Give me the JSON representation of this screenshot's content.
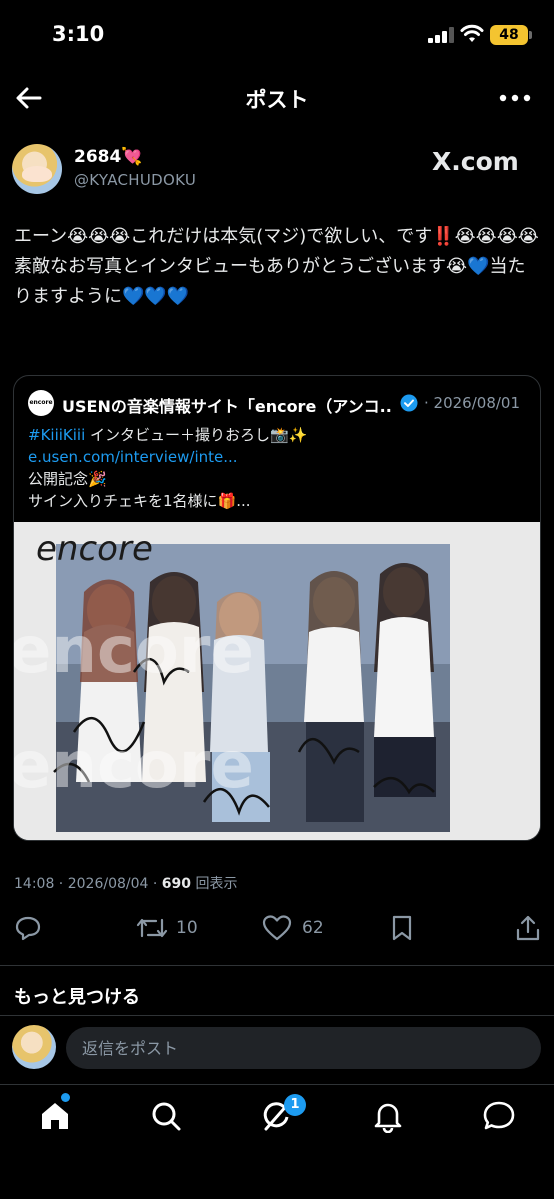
{
  "status_bar": {
    "time": "3:10",
    "battery": "48"
  },
  "nav": {
    "title": "ポスト"
  },
  "author": {
    "name": "2684💘",
    "handle": "@KYACHUDOKU",
    "watermark": "X.com"
  },
  "tweet": {
    "text": "エーン😭😭😭これだけは本気(マジ)で欲しい、です‼️😭😭😭😭\n素敵なお写真とインタビューもありがとうございます😭💙当たりますように💙💙💙"
  },
  "quote": {
    "logo_text": "encore",
    "account_name": "USENの音楽情報サイト「encore（アンコ...",
    "date": "2026/08/01",
    "hashtag": "#KiiiKiii",
    "line1_rest": " インタビュー＋撮りおろし📸✨",
    "link": "e.usen.com/interview/inte...",
    "line3": "公開記念🎉",
    "line4": "サイン入りチェキを1名様に🎁...",
    "image_watermark": "encore"
  },
  "meta": {
    "time": "14:08",
    "date": "2026/08/04",
    "views": "690",
    "views_label": "回表示"
  },
  "actions": {
    "retweets": "10",
    "likes": "62"
  },
  "discover_label": "もっと見つける",
  "reply": {
    "placeholder": "返信をポスト"
  },
  "tabbar": {
    "notifications_badge": "1"
  },
  "colors": {
    "accent": "#1d9bf0",
    "background": "#000000",
    "muted": "#8b98a5",
    "border": "#2f3336",
    "battery": "#f4c430"
  },
  "icons": [
    "back-arrow-icon",
    "more-icon",
    "verified-icon",
    "reply-icon",
    "retweet-icon",
    "like-icon",
    "bookmark-icon",
    "share-icon",
    "home-icon",
    "search-icon",
    "grok-icon",
    "bell-icon",
    "messages-icon"
  ]
}
